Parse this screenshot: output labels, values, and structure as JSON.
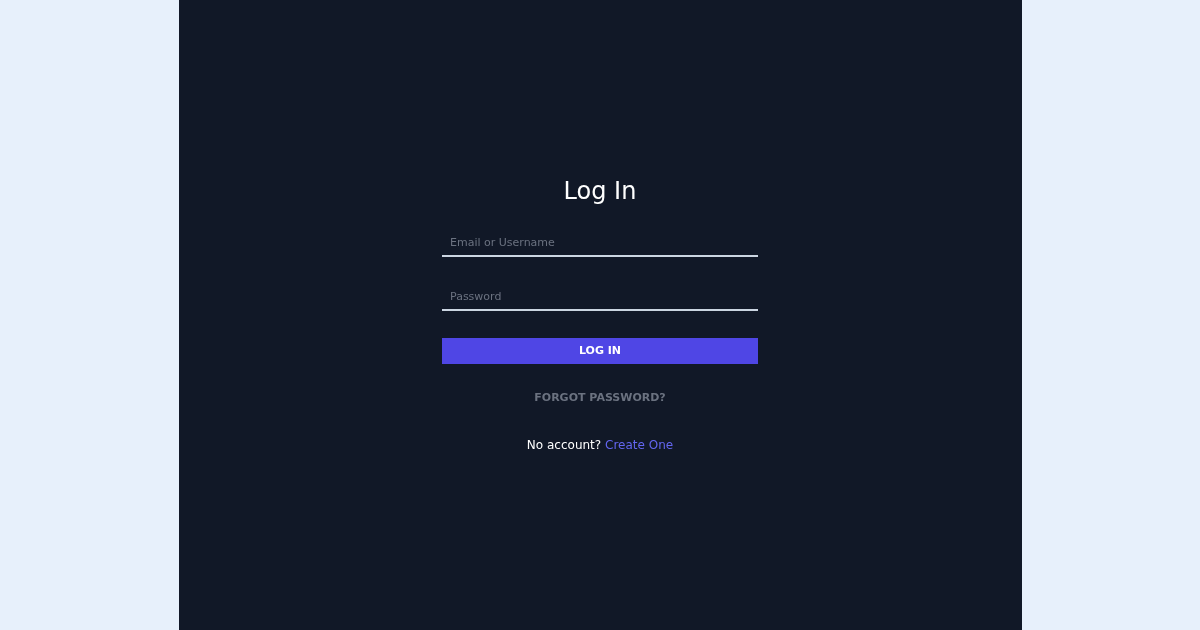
{
  "title": "Log In",
  "fields": [
    {
      "placeholder": "Email or Username"
    },
    {
      "placeholder": "Password"
    }
  ],
  "submit": "LOG IN",
  "forgot_link": "FORGOT PASSWORD?",
  "signup": {
    "text": "No account?",
    "link": "Create One"
  }
}
